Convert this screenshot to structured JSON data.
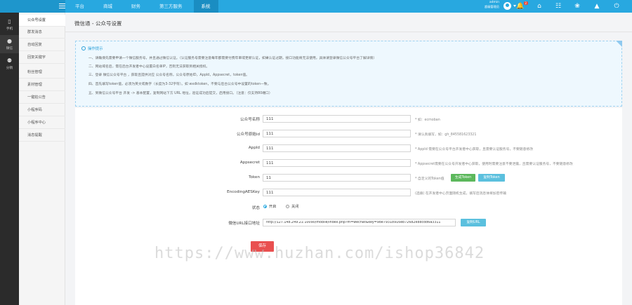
{
  "topnav": {
    "items": [
      "平台",
      "商城",
      "财务",
      "第三方服务",
      "系统"
    ],
    "active_index": 4
  },
  "user": {
    "name": "admin",
    "role": "超级管理员"
  },
  "notifications": {
    "count": "2"
  },
  "iconbar": {
    "items": [
      {
        "label": "手机",
        "icon": "mobile-icon"
      },
      {
        "label": "微信",
        "icon": "wechat-icon"
      },
      {
        "label": "分销",
        "icon": "distribution-icon"
      }
    ],
    "active_index": 1
  },
  "sidebar": {
    "items": [
      "公众号设置",
      "群发消息",
      "自动回复",
      "回复关键字",
      "粉丝管理",
      "素材管理",
      "一键拍公告",
      "小程序码",
      "小程序中心",
      "消息提醒"
    ],
    "active_index": 0
  },
  "page": {
    "title": "微信通 - 公众号设置"
  },
  "tips": {
    "heading": "操作提示",
    "lines": [
      "一、请确保先需要申请一个微信服务号，并且通过微信认证。（认证服务号需要注意每年都需要付费年审或更新认证，如果认证过期，接口功能将无法使用，具体请登录微信公众号平台了解详情）",
      "二、网站域名后，需在后台开发者中心设置白名单IP，否则无法获取到相关授权。",
      "三、登录 微信公众号平台 ，获取且提供对应 公众号名称，公众号原始ID，AppId，Appsecret，token值。",
      "四、首先填写token值，必须为英文或数字（长度为3-32字符）。如 wxdktoken，不要与后台公众号中设置的token一致。",
      "五、到微信公众号平台 开发 -> 基本配置，复制网站下方 URL 地址，验证成功后提交，启用接口。（注意：仅支持80端口）"
    ],
    "link_text": "微信公众号平台"
  },
  "form": {
    "fields": [
      {
        "label": "公众号名称",
        "value": "111",
        "hint": "* 如：ecmoban"
      },
      {
        "label": "公众号原始id",
        "value": "111",
        "hint": "* 请认真填写，如：gh_845581623321"
      },
      {
        "label": "AppId",
        "value": "111",
        "hint": "* AppId 需要在公众号平台开发者中心获取，且需要认证服务号，不要随意修改"
      },
      {
        "label": "Appsecret",
        "value": "111",
        "hint": "* Appsecret需要在公众号开发者中心获取，使用时需要注意不要泄露，且需要认证服务号，不要随意修改"
      },
      {
        "label": "Token",
        "value": "11",
        "hint": "* 自定义的Token值"
      },
      {
        "label": "EncodingAESKey",
        "value": "111",
        "hint": "(选填) 在开发者中心页面随机生成，填写后消息体将加密传输"
      }
    ],
    "token_buttons": {
      "generate": "生成Token",
      "copy": "复制Token"
    },
    "status": {
      "label": "状态",
      "options": [
        "开启",
        "关闭"
      ],
      "selected": 0
    },
    "url": {
      "label": "微信URL接口地址",
      "value": "http://127.148.249.21:10090/mobile/index.php?m=wechat&key=98e79318916eb72682e88cdd6a3311",
      "button": "复制URL"
    },
    "save_label": "保存"
  },
  "watermark": "https://www.huzhan.com/ishop36842",
  "colors": {
    "primary": "#28a8e0",
    "danger": "#e95050",
    "success": "#5cb85c",
    "info": "#5bc0de"
  }
}
